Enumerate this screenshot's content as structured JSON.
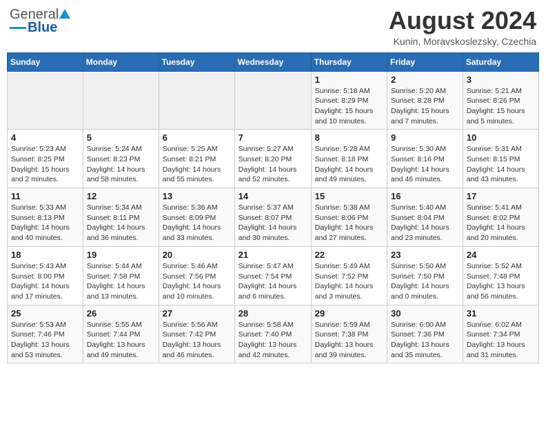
{
  "header": {
    "logo_general": "General",
    "logo_blue": "Blue",
    "month_year": "August 2024",
    "location": "Kunin, Moravskoslezsky, Czechia"
  },
  "days_of_week": [
    "Sunday",
    "Monday",
    "Tuesday",
    "Wednesday",
    "Thursday",
    "Friday",
    "Saturday"
  ],
  "weeks": [
    [
      {
        "day": "",
        "info": ""
      },
      {
        "day": "",
        "info": ""
      },
      {
        "day": "",
        "info": ""
      },
      {
        "day": "",
        "info": ""
      },
      {
        "day": "1",
        "info": "Sunrise: 5:18 AM\nSunset: 8:29 PM\nDaylight: 15 hours\nand 10 minutes."
      },
      {
        "day": "2",
        "info": "Sunrise: 5:20 AM\nSunset: 8:28 PM\nDaylight: 15 hours\nand 7 minutes."
      },
      {
        "day": "3",
        "info": "Sunrise: 5:21 AM\nSunset: 8:26 PM\nDaylight: 15 hours\nand 5 minutes."
      }
    ],
    [
      {
        "day": "4",
        "info": "Sunrise: 5:23 AM\nSunset: 8:25 PM\nDaylight: 15 hours\nand 2 minutes."
      },
      {
        "day": "5",
        "info": "Sunrise: 5:24 AM\nSunset: 8:23 PM\nDaylight: 14 hours\nand 58 minutes."
      },
      {
        "day": "6",
        "info": "Sunrise: 5:25 AM\nSunset: 8:21 PM\nDaylight: 14 hours\nand 55 minutes."
      },
      {
        "day": "7",
        "info": "Sunrise: 5:27 AM\nSunset: 8:20 PM\nDaylight: 14 hours\nand 52 minutes."
      },
      {
        "day": "8",
        "info": "Sunrise: 5:28 AM\nSunset: 8:18 PM\nDaylight: 14 hours\nand 49 minutes."
      },
      {
        "day": "9",
        "info": "Sunrise: 5:30 AM\nSunset: 8:16 PM\nDaylight: 14 hours\nand 46 minutes."
      },
      {
        "day": "10",
        "info": "Sunrise: 5:31 AM\nSunset: 8:15 PM\nDaylight: 14 hours\nand 43 minutes."
      }
    ],
    [
      {
        "day": "11",
        "info": "Sunrise: 5:33 AM\nSunset: 8:13 PM\nDaylight: 14 hours\nand 40 minutes."
      },
      {
        "day": "12",
        "info": "Sunrise: 5:34 AM\nSunset: 8:11 PM\nDaylight: 14 hours\nand 36 minutes."
      },
      {
        "day": "13",
        "info": "Sunrise: 5:36 AM\nSunset: 8:09 PM\nDaylight: 14 hours\nand 33 minutes."
      },
      {
        "day": "14",
        "info": "Sunrise: 5:37 AM\nSunset: 8:07 PM\nDaylight: 14 hours\nand 30 minutes."
      },
      {
        "day": "15",
        "info": "Sunrise: 5:38 AM\nSunset: 8:06 PM\nDaylight: 14 hours\nand 27 minutes."
      },
      {
        "day": "16",
        "info": "Sunrise: 5:40 AM\nSunset: 8:04 PM\nDaylight: 14 hours\nand 23 minutes."
      },
      {
        "day": "17",
        "info": "Sunrise: 5:41 AM\nSunset: 8:02 PM\nDaylight: 14 hours\nand 20 minutes."
      }
    ],
    [
      {
        "day": "18",
        "info": "Sunrise: 5:43 AM\nSunset: 8:00 PM\nDaylight: 14 hours\nand 17 minutes."
      },
      {
        "day": "19",
        "info": "Sunrise: 5:44 AM\nSunset: 7:58 PM\nDaylight: 14 hours\nand 13 minutes."
      },
      {
        "day": "20",
        "info": "Sunrise: 5:46 AM\nSunset: 7:56 PM\nDaylight: 14 hours\nand 10 minutes."
      },
      {
        "day": "21",
        "info": "Sunrise: 5:47 AM\nSunset: 7:54 PM\nDaylight: 14 hours\nand 6 minutes."
      },
      {
        "day": "22",
        "info": "Sunrise: 5:49 AM\nSunset: 7:52 PM\nDaylight: 14 hours\nand 3 minutes."
      },
      {
        "day": "23",
        "info": "Sunrise: 5:50 AM\nSunset: 7:50 PM\nDaylight: 14 hours\nand 0 minutes."
      },
      {
        "day": "24",
        "info": "Sunrise: 5:52 AM\nSunset: 7:48 PM\nDaylight: 13 hours\nand 56 minutes."
      }
    ],
    [
      {
        "day": "25",
        "info": "Sunrise: 5:53 AM\nSunset: 7:46 PM\nDaylight: 13 hours\nand 53 minutes."
      },
      {
        "day": "26",
        "info": "Sunrise: 5:55 AM\nSunset: 7:44 PM\nDaylight: 13 hours\nand 49 minutes."
      },
      {
        "day": "27",
        "info": "Sunrise: 5:56 AM\nSunset: 7:42 PM\nDaylight: 13 hours\nand 46 minutes."
      },
      {
        "day": "28",
        "info": "Sunrise: 5:58 AM\nSunset: 7:40 PM\nDaylight: 13 hours\nand 42 minutes."
      },
      {
        "day": "29",
        "info": "Sunrise: 5:59 AM\nSunset: 7:38 PM\nDaylight: 13 hours\nand 39 minutes."
      },
      {
        "day": "30",
        "info": "Sunrise: 6:00 AM\nSunset: 7:36 PM\nDaylight: 13 hours\nand 35 minutes."
      },
      {
        "day": "31",
        "info": "Sunrise: 6:02 AM\nSunset: 7:34 PM\nDaylight: 13 hours\nand 31 minutes."
      }
    ]
  ]
}
